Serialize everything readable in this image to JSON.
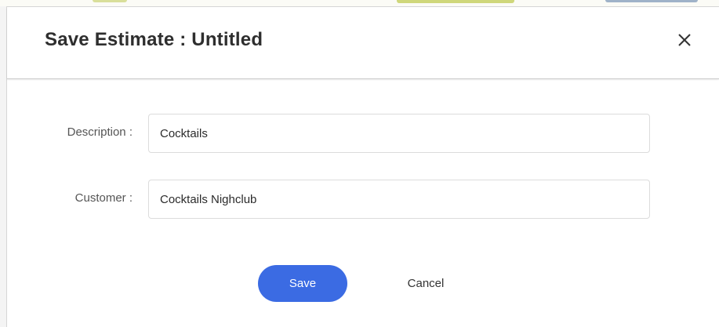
{
  "dialog": {
    "title": "Save Estimate : Untitled",
    "close_icon": "close-icon"
  },
  "form": {
    "description": {
      "label": "Description :",
      "value": "Cocktails"
    },
    "customer": {
      "label": "Customer :",
      "value": "Cocktails Nighclub"
    }
  },
  "actions": {
    "save_label": "Save",
    "cancel_label": "Cancel"
  },
  "colors": {
    "primary_button": "#3b6be3",
    "title_text": "#2e2e2e"
  }
}
